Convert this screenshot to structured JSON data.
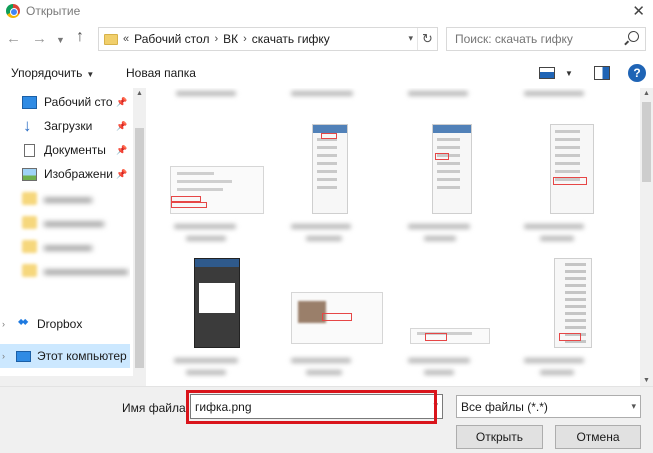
{
  "window": {
    "title": "Открытие"
  },
  "address": {
    "overflow_marker": "«",
    "breadcrumbs": [
      "Рабочий стол",
      "ВК",
      "скачать гифку"
    ],
    "separator": "›"
  },
  "search": {
    "placeholder": "Поиск: скачать гифку"
  },
  "toolbar": {
    "organize_label": "Упорядочить",
    "new_folder_label": "Новая папка",
    "help_label": "?"
  },
  "sidebar": {
    "items": [
      {
        "label": "Рабочий сто",
        "icon": "desktop-icon",
        "pinned": true
      },
      {
        "label": "Загрузки",
        "icon": "download-icon",
        "pinned": true
      },
      {
        "label": "Документы",
        "icon": "documents-icon",
        "pinned": true
      },
      {
        "label": "Изображени",
        "icon": "pictures-icon",
        "pinned": true
      },
      {
        "label": "",
        "icon": "folder-icon",
        "blurred": true
      },
      {
        "label": "",
        "icon": "folder-icon",
        "blurred": true
      },
      {
        "label": "",
        "icon": "folder-icon",
        "blurred": true
      },
      {
        "label": "",
        "icon": "folder-icon",
        "blurred": true
      },
      {
        "label": "Dropbox",
        "icon": "dropbox-icon"
      },
      {
        "label": "Этот компьютер",
        "icon": "computer-icon",
        "selected": true
      }
    ]
  },
  "footer": {
    "filename_label": "Имя файла:",
    "filename_value": "гифка.png",
    "filetype_value": "Все файлы (*.*)",
    "open_label": "Открыть",
    "cancel_label": "Отмена"
  },
  "colors": {
    "highlight": "#d9141b",
    "selection": "#cce8ff",
    "accent": "#1f64b5"
  }
}
